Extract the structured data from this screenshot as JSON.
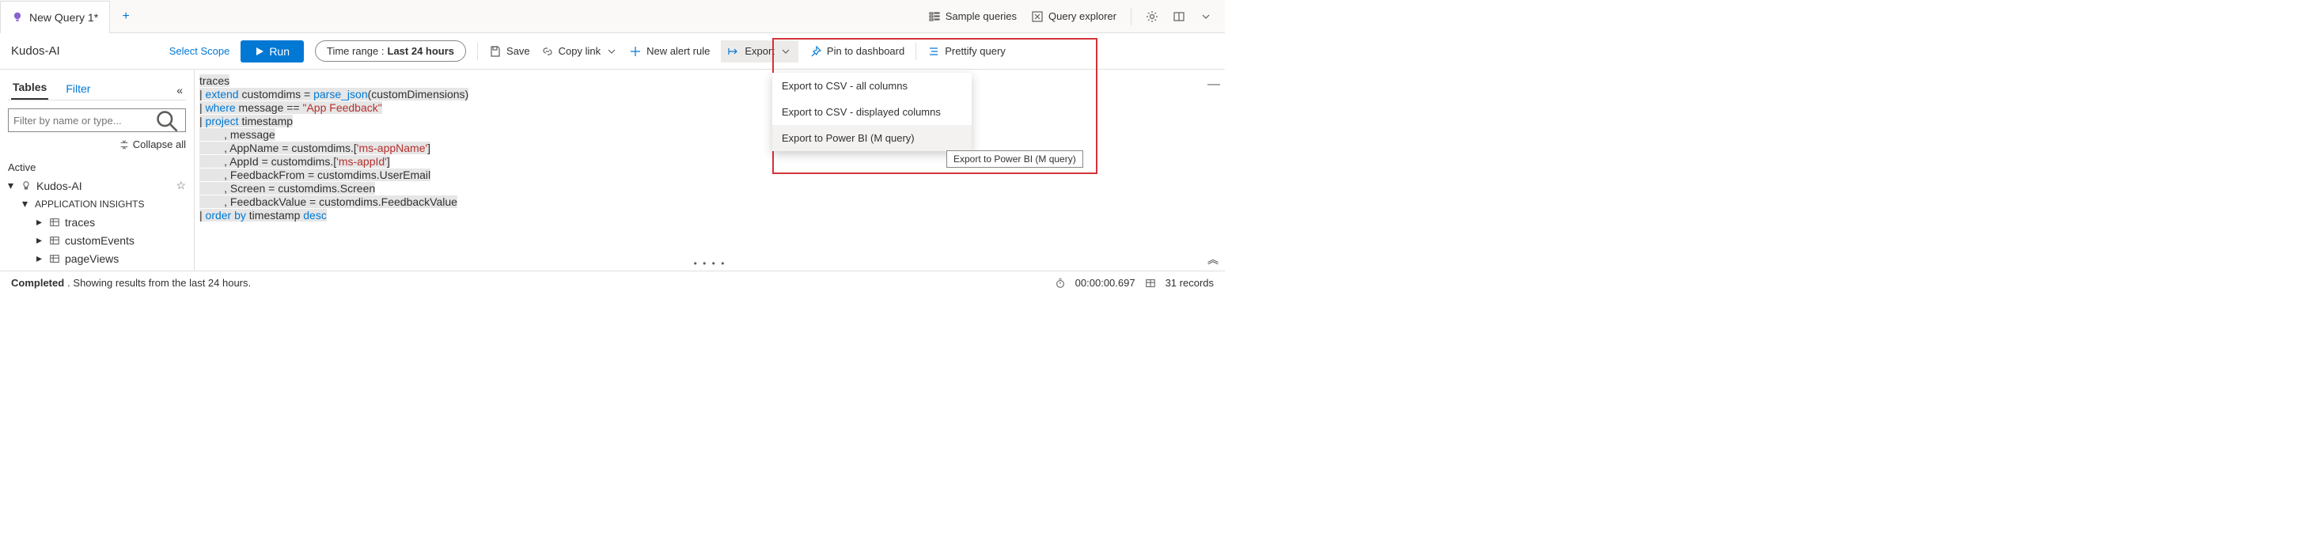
{
  "tab": {
    "title": "New Query 1*"
  },
  "top_right": {
    "sample_queries": "Sample queries",
    "query_explorer": "Query explorer"
  },
  "toolbar": {
    "scope": "Kudos-AI",
    "select_scope": "Select Scope",
    "run": "Run",
    "time_range_label": "Time range :",
    "time_range_value": "Last 24 hours",
    "save": "Save",
    "copy_link": "Copy link",
    "new_alert": "New alert rule",
    "export": "Export",
    "pin": "Pin to dashboard",
    "prettify": "Prettify query"
  },
  "sidebar": {
    "tabs": {
      "tables": "Tables",
      "filter": "Filter"
    },
    "search_placeholder": "Filter by name or type...",
    "collapse_all": "Collapse all",
    "active_header": "Active",
    "root": "Kudos-AI",
    "group": "APPLICATION INSIGHTS",
    "items": [
      "traces",
      "customEvents",
      "pageViews"
    ]
  },
  "query": {
    "lines": [
      {
        "pre": "",
        "body": [
          {
            "t": "traces",
            "c": ""
          }
        ]
      },
      {
        "pre": "| ",
        "body": [
          {
            "t": "extend",
            "c": "kw"
          },
          {
            "t": " customdims = ",
            "c": ""
          },
          {
            "t": "parse_json",
            "c": "fn"
          },
          {
            "t": "(customDimensions)",
            "c": ""
          }
        ]
      },
      {
        "pre": "| ",
        "body": [
          {
            "t": "where",
            "c": "kw"
          },
          {
            "t": " message == ",
            "c": ""
          },
          {
            "t": "\"App Feedback\"",
            "c": "str"
          }
        ]
      },
      {
        "pre": "| ",
        "body": [
          {
            "t": "project",
            "c": "kw"
          },
          {
            "t": " timestamp",
            "c": ""
          }
        ]
      },
      {
        "pre": "        , ",
        "body": [
          {
            "t": "message",
            "c": ""
          }
        ]
      },
      {
        "pre": "        , ",
        "body": [
          {
            "t": "AppName = customdims.[",
            "c": ""
          },
          {
            "t": "'ms-appName'",
            "c": "str"
          },
          {
            "t": "]",
            "c": ""
          }
        ]
      },
      {
        "pre": "        , ",
        "body": [
          {
            "t": "AppId = customdims.[",
            "c": ""
          },
          {
            "t": "'ms-appId'",
            "c": "str"
          },
          {
            "t": "]",
            "c": ""
          }
        ]
      },
      {
        "pre": "        , ",
        "body": [
          {
            "t": "FeedbackFrom = customdims.UserEmail",
            "c": ""
          }
        ]
      },
      {
        "pre": "        , ",
        "body": [
          {
            "t": "Screen = customdims.Screen",
            "c": ""
          }
        ]
      },
      {
        "pre": "        , ",
        "body": [
          {
            "t": "FeedbackValue = customdims.FeedbackValue",
            "c": ""
          }
        ]
      },
      {
        "pre": "| ",
        "body": [
          {
            "t": "order by",
            "c": "kw"
          },
          {
            "t": " timestamp ",
            "c": ""
          },
          {
            "t": "desc",
            "c": "kw"
          }
        ]
      }
    ]
  },
  "export_menu": {
    "items": [
      "Export to CSV - all columns",
      "Export to CSV - displayed columns",
      "Export to Power BI (M query)"
    ],
    "highlighted_index": 2,
    "tooltip": "Export to Power BI (M query)"
  },
  "status": {
    "completed": "Completed",
    "text": ". Showing results from the last 24 hours.",
    "duration": "00:00:00.697",
    "records": "31 records"
  }
}
